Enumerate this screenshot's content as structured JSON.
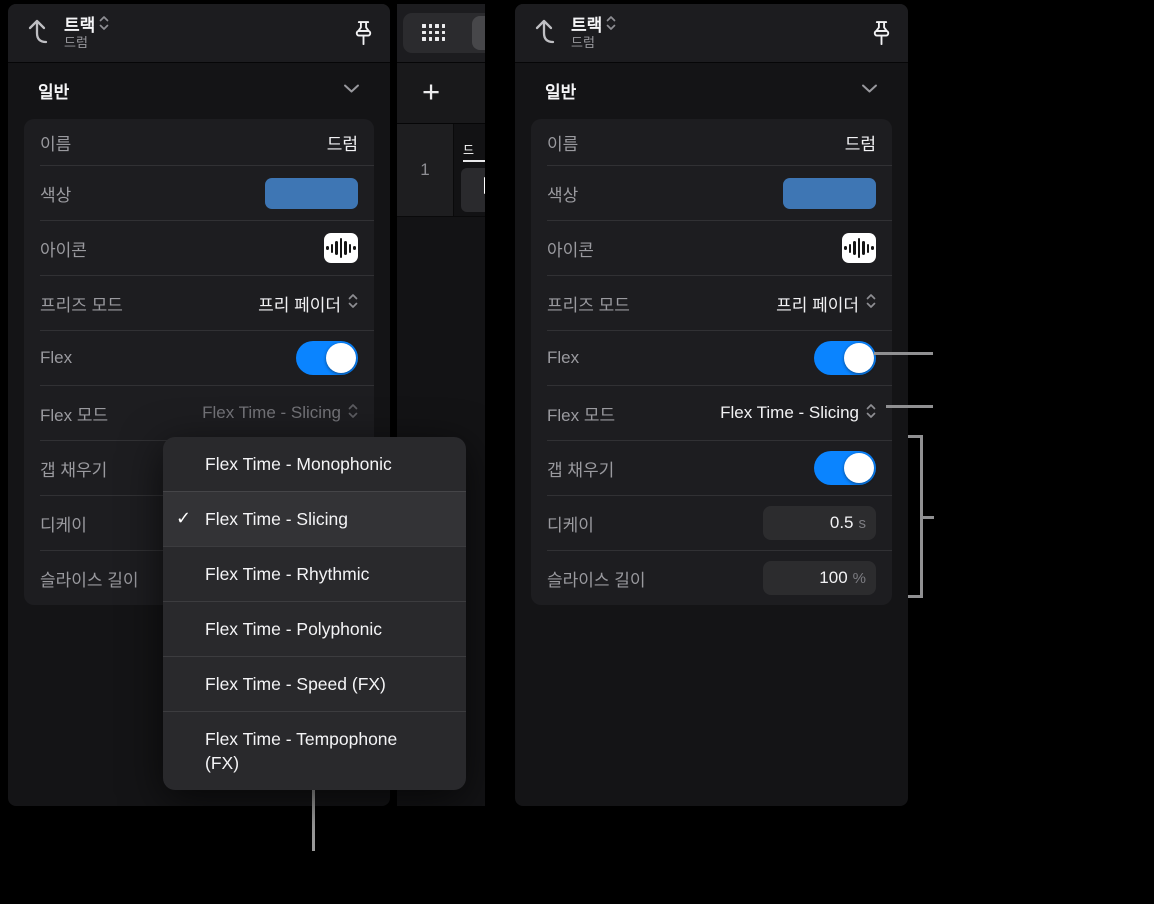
{
  "accent": {
    "toggle_on": "#0a84ff",
    "track_color": "#3e76b4",
    "callout": "#909092"
  },
  "left_panel": {
    "header": {
      "title": "트랙",
      "subtitle": "드럼"
    },
    "section_title": "일반",
    "rows": {
      "name": {
        "label": "이름",
        "value": "드럼"
      },
      "color": {
        "label": "색상"
      },
      "icon": {
        "label": "아이콘"
      },
      "freeze": {
        "label": "프리즈 모드",
        "value": "프리 페이더"
      },
      "flex": {
        "label": "Flex"
      },
      "flex_mode": {
        "label": "Flex 모드",
        "value": "Flex Time - Slicing"
      },
      "gap_fill": {
        "label": "갭 채우기"
      },
      "decay": {
        "label": "디케이"
      },
      "slice_length": {
        "label": "슬라이스 길이"
      }
    }
  },
  "right_panel": {
    "header": {
      "title": "트랙",
      "subtitle": "드럼"
    },
    "section_title": "일반",
    "rows": {
      "name": {
        "label": "이름",
        "value": "드럼"
      },
      "color": {
        "label": "색상"
      },
      "icon": {
        "label": "아이콘"
      },
      "freeze": {
        "label": "프리즈 모드",
        "value": "프리 페이더"
      },
      "flex": {
        "label": "Flex"
      },
      "flex_mode": {
        "label": "Flex 모드",
        "value": "Flex Time - Slicing"
      },
      "gap_fill": {
        "label": "갭 채우기"
      },
      "decay": {
        "label": "디케이",
        "value": "0.5",
        "unit": "s"
      },
      "slice_length": {
        "label": "슬라이스 길이",
        "value": "100",
        "unit": "%"
      }
    }
  },
  "dropdown": {
    "check_glyph": "✓",
    "items": [
      {
        "label": "Flex Time - Monophonic",
        "checked": false
      },
      {
        "label": "Flex Time - Slicing",
        "checked": true
      },
      {
        "label": "Flex Time - Rhythmic",
        "checked": false
      },
      {
        "label": "Flex Time - Polyphonic",
        "checked": false
      },
      {
        "label": "Flex Time - Speed (FX)",
        "checked": false
      },
      {
        "label": "Flex Time - Tempophone (FX)",
        "checked": false
      }
    ]
  },
  "tracks_strip": {
    "add_button": "+",
    "track_number": "1",
    "track_name_partial": "드"
  }
}
